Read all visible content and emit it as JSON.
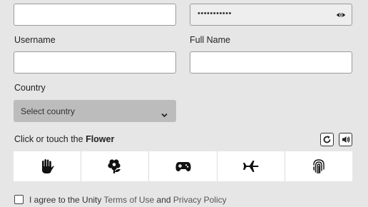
{
  "fields": {
    "email_value": "",
    "password_masked": "•••••••••••",
    "username_label": "Username",
    "username_value": "",
    "fullname_label": "Full Name",
    "fullname_value": "",
    "country_label": "Country",
    "country_selected": "Select country"
  },
  "captcha": {
    "prompt_prefix": "Click or touch the",
    "prompt_target": "Flower",
    "icons": [
      "hand-icon",
      "flower-icon",
      "gamepad-icon",
      "airplane-icon",
      "fingerprint-icon"
    ],
    "refresh_icon": "refresh-icon",
    "audio_icon": "audio-icon"
  },
  "agreement": {
    "text_start": "I agree to the Unity",
    "terms_link": "Terms of Use",
    "and_word": "and",
    "privacy_link": "Privacy Policy",
    "checked": false
  }
}
